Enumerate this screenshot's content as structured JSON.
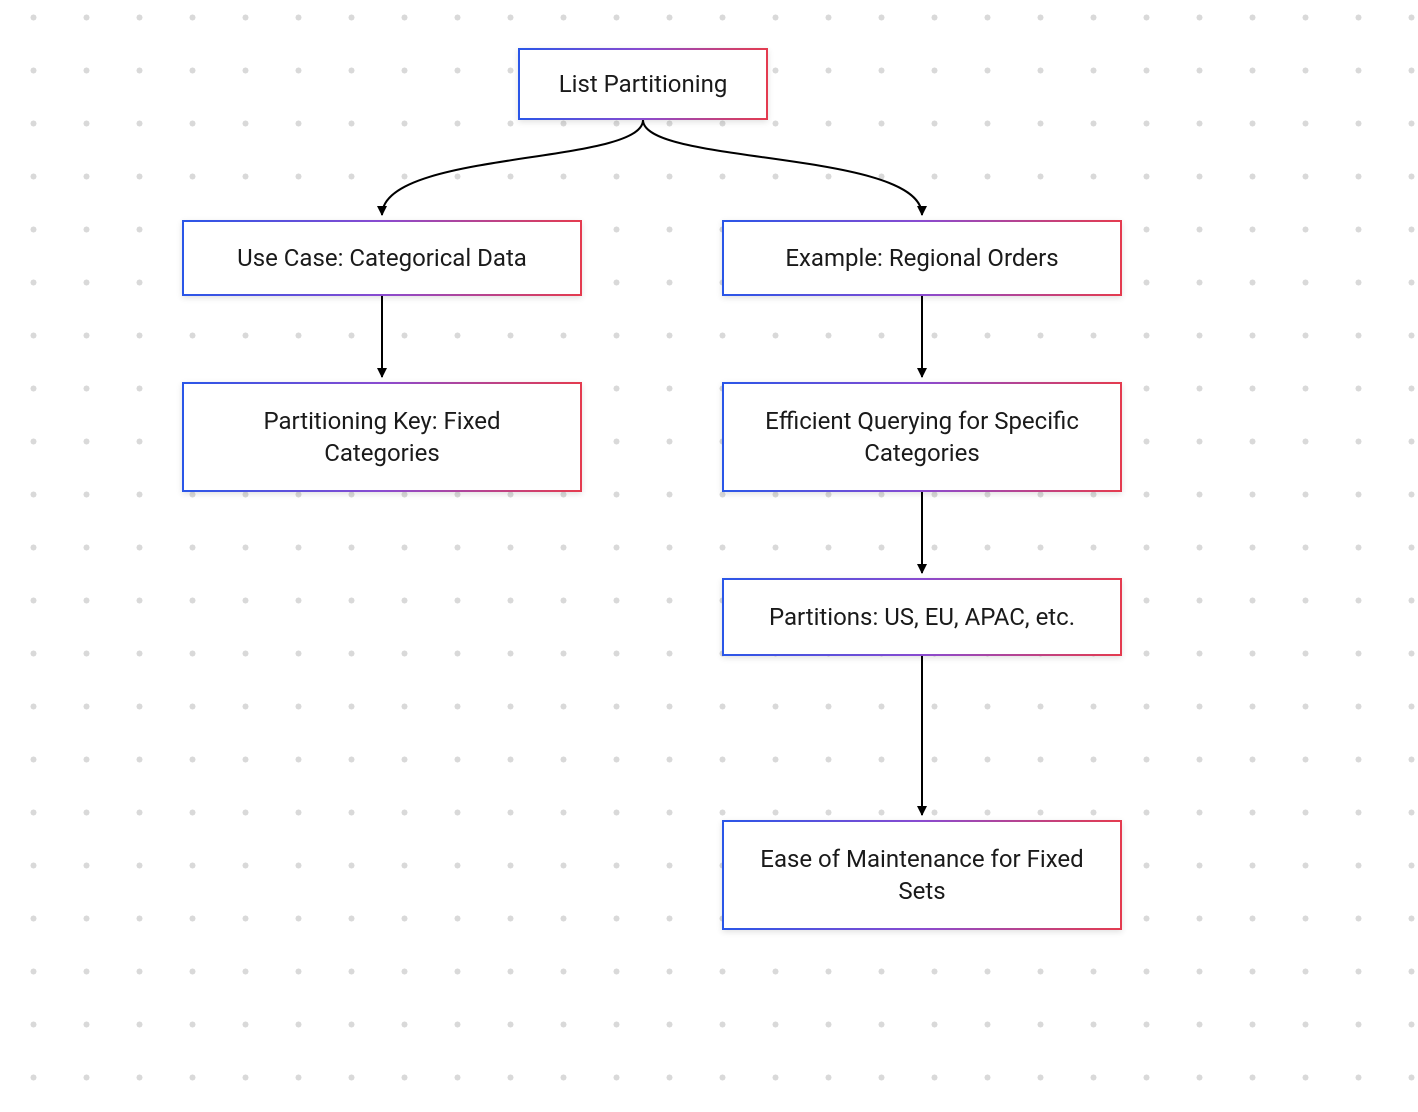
{
  "diagram": {
    "title": "List Partitioning",
    "nodes": {
      "root": {
        "label": "List Partitioning"
      },
      "usecase": {
        "label": "Use Case: Categorical Data"
      },
      "example": {
        "label": "Example: Regional Orders"
      },
      "key": {
        "label": "Partitioning Key: Fixed Categories"
      },
      "querying": {
        "label": "Efficient Querying for Specific Categories"
      },
      "partitions": {
        "label": "Partitions: US, EU, APAC, etc."
      },
      "maintenance": {
        "label": "Ease of Maintenance for Fixed Sets"
      }
    },
    "edges": [
      {
        "from": "root",
        "to": "usecase"
      },
      {
        "from": "root",
        "to": "example"
      },
      {
        "from": "usecase",
        "to": "key"
      },
      {
        "from": "example",
        "to": "querying"
      },
      {
        "from": "querying",
        "to": "partitions"
      },
      {
        "from": "partitions",
        "to": "maintenance"
      }
    ],
    "style": {
      "border_gradient": [
        "#2a56e8",
        "#8a4bd0",
        "#e43b4f"
      ],
      "edge_color": "#000000",
      "background": "#ffffff",
      "dot_color": "#d9d9d9"
    }
  }
}
